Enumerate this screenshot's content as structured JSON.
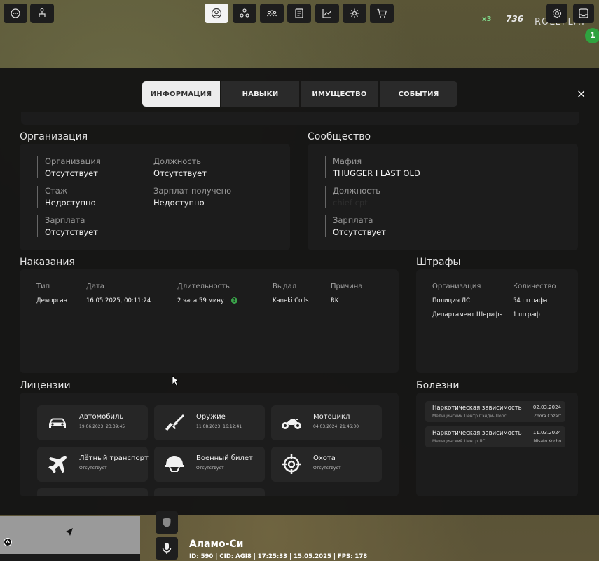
{
  "hud": {
    "badge_count": "736",
    "badge_x": "x3",
    "server_text": "ROLEPLAY",
    "notification_count": "1"
  },
  "tabs": [
    {
      "label": "ИНФОРМАЦИЯ",
      "active": true
    },
    {
      "label": "НАВЫКИ",
      "active": false
    },
    {
      "label": "ИМУЩЕСТВО",
      "active": false
    },
    {
      "label": "СОБЫТИЯ",
      "active": false
    }
  ],
  "close_label": "×",
  "organization": {
    "title": "Организация",
    "fields": [
      {
        "label": "Организация",
        "value": "Отсутствует"
      },
      {
        "label": "Должность",
        "value": "Отсутствует"
      },
      {
        "label": "Стаж",
        "value": "Недоступно"
      },
      {
        "label": "Зарплат получено",
        "value": "Недоступно"
      },
      {
        "label": "Зарплата",
        "value": "Отсутствует"
      }
    ]
  },
  "community": {
    "title": "Сообщество",
    "fields": [
      {
        "label": "Мафия",
        "value": "THUGGER I LAST OLD"
      },
      {
        "label": "Должность",
        "value": "chief cpt"
      },
      {
        "label": "Зарплата",
        "value": "Отсутствует"
      }
    ]
  },
  "punishments": {
    "title": "Наказания",
    "headers": [
      "Тип",
      "Дата",
      "Длительность",
      "Выдал",
      "Причина"
    ],
    "rows": [
      {
        "type": "Деморган",
        "date": "16.05.2025, 00:11:24",
        "duration": "2 часа 59 минут",
        "issuer": "Kaneki Coils",
        "reason": "RK"
      }
    ]
  },
  "fines": {
    "title": "Штрафы",
    "headers": [
      "Организация",
      "Количество"
    ],
    "rows": [
      {
        "org": "Полиция ЛС",
        "count": "54 штрафа"
      },
      {
        "org": "Департамент Шерифа",
        "count": "1 штраф"
      }
    ]
  },
  "licenses": {
    "title": "Лицензии",
    "items": [
      {
        "name": "Автомобиль",
        "date": "19.06.2023, 23:39:45",
        "icon": "car-icon"
      },
      {
        "name": "Оружие",
        "date": "11.08.2023, 16:12:41",
        "icon": "rifle-icon"
      },
      {
        "name": "Мотоцикл",
        "date": "04.03.2024, 21:46:00",
        "icon": "motorcycle-icon"
      },
      {
        "name": "Лётный транспорт",
        "date": "Отсутствует",
        "icon": "plane-icon"
      },
      {
        "name": "Военный билет",
        "date": "Отсутствует",
        "icon": "helmet-icon"
      },
      {
        "name": "Охота",
        "date": "Отсутствует",
        "icon": "crosshair-icon"
      }
    ]
  },
  "diseases": {
    "title": "Болезни",
    "items": [
      {
        "name": "Наркотическая зависимость",
        "date": "02.03.2024",
        "clinic": "Медицинский Центр Сэнди-Шорс",
        "doctor": "Zhora Cozart"
      },
      {
        "name": "Наркотическая зависимость",
        "date": "11.03.2024",
        "clinic": "Медицинский Центр ЛС",
        "doctor": "Misato Kocho"
      }
    ]
  },
  "bottom": {
    "location": "Аламо-Си",
    "info": "ID: 590 | CID: AGI8 | 17:25:33   | 15.05.2025 | FPS: 178"
  },
  "colors": {
    "accent_green": "#3aa44a",
    "panel": "#141414",
    "card": "#1c1c1c"
  }
}
